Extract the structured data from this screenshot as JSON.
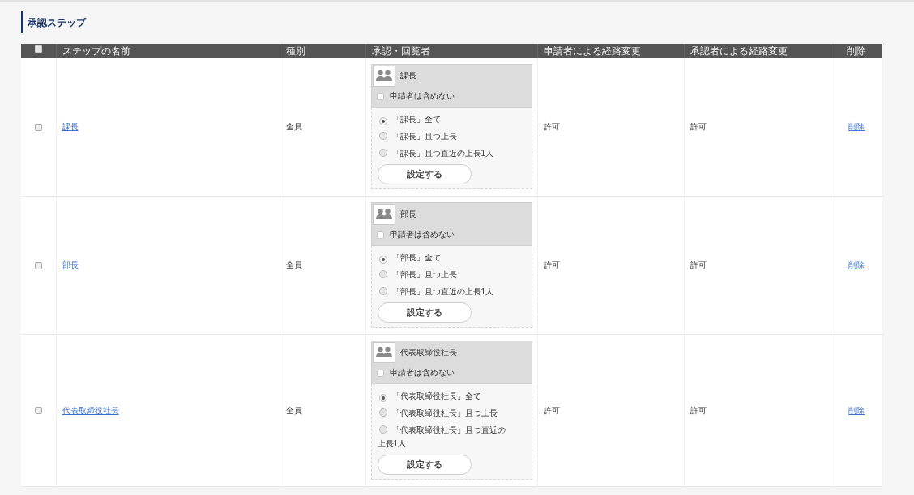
{
  "section": {
    "title": "承認ステップ"
  },
  "table": {
    "select_all": {
      "checked": false
    },
    "columns": [
      "ステップの名前",
      "種別",
      "承認・回覧者",
      "申請者による経路変更",
      "承認者による経路変更",
      "削除"
    ],
    "rows": [
      {
        "checked": false,
        "name": "課長",
        "type": "全員",
        "approver": {
          "name": "課長",
          "exclude_applicant": {
            "label": "申請者は含めない",
            "checked": false
          },
          "options": [
            {
              "label": "「課長」全て",
              "selected": true
            },
            {
              "label": "「課長」且つ上長",
              "selected": false
            },
            {
              "label": "「課長」且つ直近の上長1人",
              "selected": false
            }
          ],
          "button": "設定する"
        },
        "applicant_route_change": "許可",
        "approver_route_change": "許可",
        "delete": "削除"
      },
      {
        "checked": false,
        "name": "部長",
        "type": "全員",
        "approver": {
          "name": "部長",
          "exclude_applicant": {
            "label": "申請者は含めない",
            "checked": false
          },
          "options": [
            {
              "label": "「部長」全て",
              "selected": true
            },
            {
              "label": "「部長」且つ上長",
              "selected": false
            },
            {
              "label": "「部長」且つ直近の上長1人",
              "selected": false
            }
          ],
          "button": "設定する"
        },
        "applicant_route_change": "許可",
        "approver_route_change": "許可",
        "delete": "削除"
      },
      {
        "checked": false,
        "name": "代表取締役社長",
        "type": "全員",
        "approver": {
          "name": "代表取締役社長",
          "exclude_applicant": {
            "label": "申請者は含めない",
            "checked": false
          },
          "options": [
            {
              "label": "「代表取締役社長」全て",
              "selected": true
            },
            {
              "label": "「代表取締役社長」且つ上長",
              "selected": false
            },
            {
              "label": "「代表取締役社長」且つ直近の上長1人",
              "selected": false
            }
          ],
          "button": "設定する"
        },
        "applicant_route_change": "許可",
        "approver_route_change": "許可",
        "delete": "削除"
      }
    ]
  }
}
